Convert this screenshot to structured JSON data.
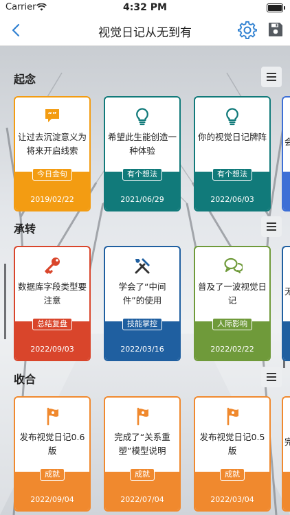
{
  "status": {
    "carrier": "Carrier",
    "time": "4:32 PM"
  },
  "nav": {
    "title": "视觉日记从无到有",
    "back_icon": "chevron-left-icon",
    "settings_icon": "gear-icon",
    "save_icon": "floppy-disk-icon"
  },
  "sections": [
    {
      "title": "起念",
      "cards": [
        {
          "text": "让过去沉淀意义为将来开启线索",
          "badge": "今日金句",
          "date": "2019/02/22",
          "color": "#f39c12",
          "icon": "quote-bubble-icon"
        },
        {
          "text": "希望此生能创造一种体验",
          "badge": "有个想法",
          "date": "2021/06/29",
          "color": "#117a7a",
          "icon": "lightbulb-icon"
        },
        {
          "text": "你的视觉日记牌阵",
          "badge": "有个想法",
          "date": "2022/06/03",
          "color": "#117a7a",
          "icon": "lightbulb-icon"
        }
      ],
      "peek_color": "#3d6fd6"
    },
    {
      "title": "承转",
      "cards": [
        {
          "text": "数据库字段类型要注意",
          "badge": "总结复盘",
          "date": "2022/09/03",
          "color": "#d9452b",
          "icon": "key-icon"
        },
        {
          "text": "学会了“中间件”的使用",
          "badge": "技能掌控",
          "date": "2022/03/16",
          "color": "#1f5fa0",
          "icon": "tools-icon"
        },
        {
          "text": "普及了一波视觉日记",
          "badge": "人际影响",
          "date": "2022/02/22",
          "color": "#6f9a3a",
          "icon": "chat-bubbles-icon"
        }
      ],
      "peek_color": "#1f5fa0"
    },
    {
      "title": "收合",
      "cards": [
        {
          "text": "发布视觉日记0.6版",
          "badge": "成就",
          "date": "2022/09/04",
          "color": "#f0892e",
          "icon": "flag-icon"
        },
        {
          "text": "完成了“关系重塑”模型说明",
          "badge": "成就",
          "date": "2022/07/04",
          "color": "#f0892e",
          "icon": "flag-icon"
        },
        {
          "text": "发布视觉日记0.5版",
          "badge": "成就",
          "date": "2022/03/04",
          "color": "#f0892e",
          "icon": "flag-icon"
        }
      ],
      "peek_color": "#f0892e"
    }
  ],
  "peek_text": [
    "会",
    "无",
    "完"
  ]
}
